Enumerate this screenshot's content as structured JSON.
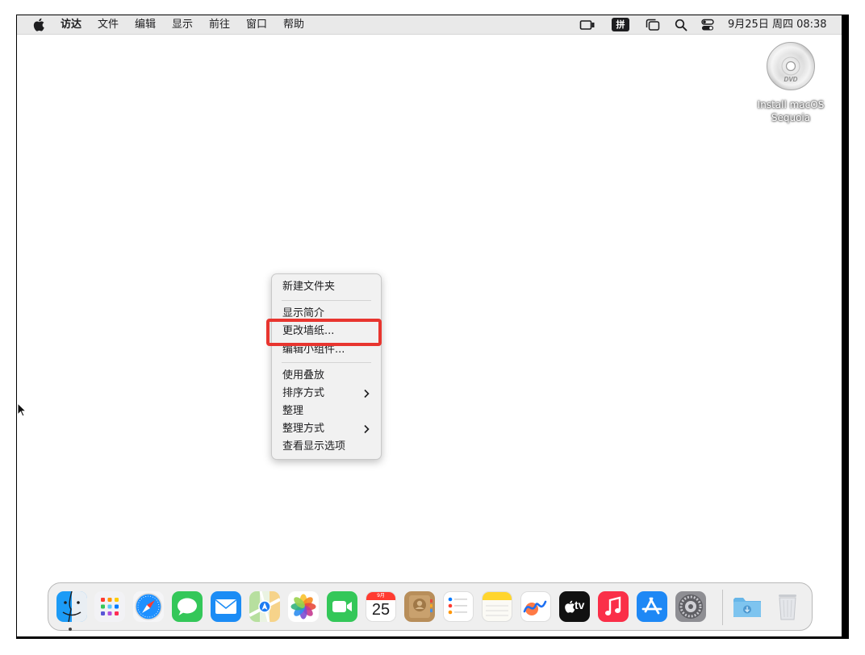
{
  "menubar": {
    "apple_icon": "apple-logo-icon",
    "app_name": "访达",
    "menus": [
      "文件",
      "编辑",
      "显示",
      "前往",
      "窗口",
      "帮助"
    ],
    "input_method_label": "拼",
    "status_icons": [
      "screen-mirroring-icon",
      "input-method-icon",
      "stage-manager-icon",
      "search-icon",
      "control-center-icon"
    ],
    "datetime": "9月25日 周四  08:38"
  },
  "desktop": {
    "disk_icon": "dvd-disk-icon",
    "disk_label_line1": "Install macOS",
    "disk_label_line2": "Sequoia"
  },
  "context_menu": {
    "new_folder": "新建文件夹",
    "get_info": "显示简介",
    "change_wallpaper": "更改墙纸...",
    "edit_widgets": "编辑小组件...",
    "use_stacks": "使用叠放",
    "sort_by": "排序方式",
    "clean_up": "整理",
    "clean_up_by": "整理方式",
    "view_options": "查看显示选项"
  },
  "highlight": {
    "target": "更改墙纸...",
    "color": "#e8352f"
  },
  "dock": {
    "apps": [
      "访达",
      "启动台",
      "Safari浏览器",
      "信息",
      "邮件",
      "地图",
      "照片",
      "FaceTime通话",
      "日历",
      "通讯录",
      "提醒事项",
      "备忘录",
      "无边记",
      "Apple TV",
      "音乐",
      "App Store",
      "系统设置"
    ],
    "calendar_month": "9月",
    "calendar_day": "25",
    "tv_label": "tv",
    "folders": [
      "下载",
      "废纸篓"
    ]
  },
  "colors": {
    "menubar_bg": "#e9e9e9",
    "menu_bg": "#f1f1f1",
    "highlight_border": "#e8352f"
  }
}
